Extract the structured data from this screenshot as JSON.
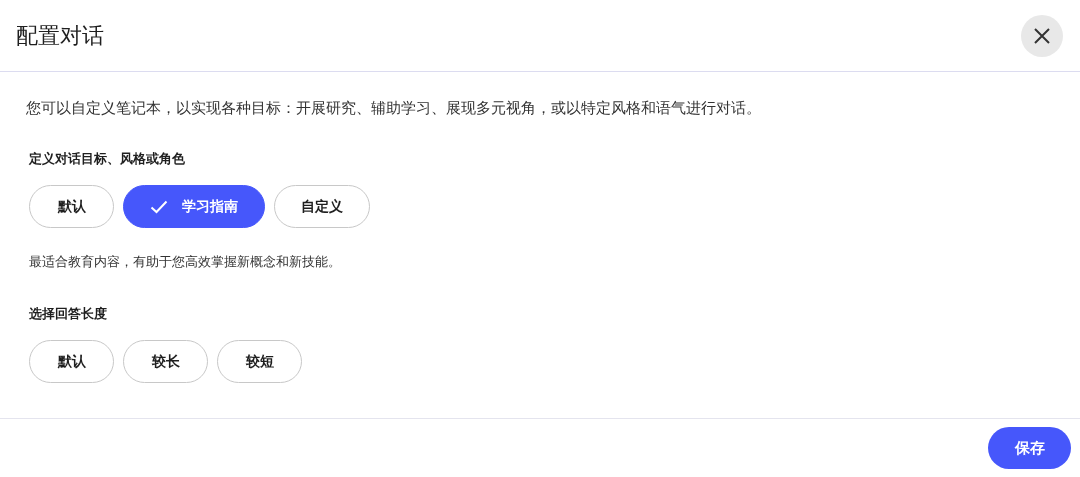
{
  "dialog": {
    "title": "配置对话"
  },
  "description": "您可以自定义笔记本，以实现各种目标：开展研究、辅助学习、展现多元视角，或以特定风格和语气进行对话。",
  "goal": {
    "label": "定义对话目标、风格或角色",
    "options": [
      {
        "label": "默认",
        "selected": false
      },
      {
        "label": "学习指南",
        "selected": true
      },
      {
        "label": "自定义",
        "selected": false
      }
    ],
    "hint": "最适合教育内容，有助于您高效掌握新概念和新技能。"
  },
  "length": {
    "label": "选择回答长度",
    "options": [
      {
        "label": "默认",
        "selected": false
      },
      {
        "label": "较长",
        "selected": false
      },
      {
        "label": "较短",
        "selected": false
      }
    ]
  },
  "footer": {
    "save_button": "保存"
  }
}
